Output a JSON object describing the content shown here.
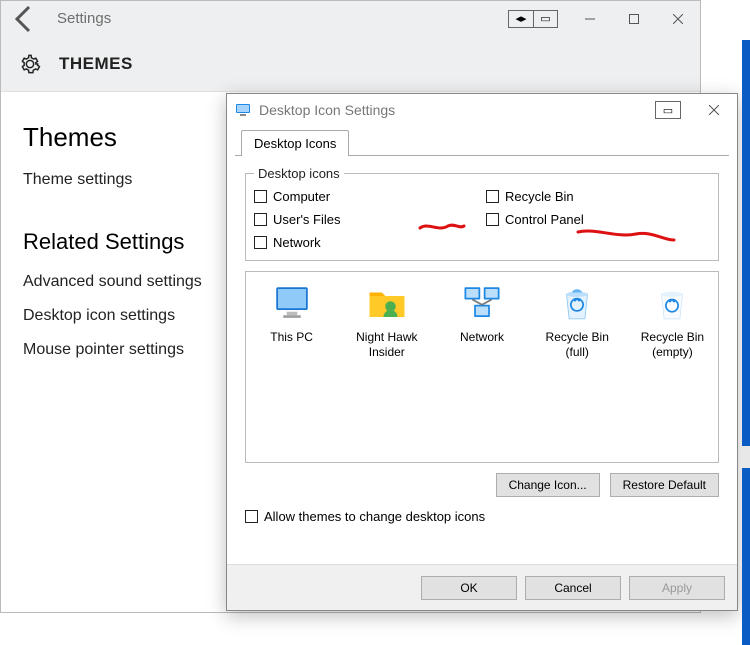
{
  "settings": {
    "app_title": "Settings",
    "header": "THEMES",
    "section_title": "Themes",
    "section_link": "Theme settings",
    "related_title": "Related Settings",
    "related_links": [
      "Advanced sound settings",
      "Desktop icon settings",
      "Mouse pointer settings"
    ]
  },
  "dialog": {
    "title": "Desktop Icon Settings",
    "tab": "Desktop Icons",
    "group_legend": "Desktop icons",
    "checkboxes": {
      "computer": "Computer",
      "recycle_bin": "Recycle Bin",
      "users_files": "User's Files",
      "control_panel": "Control Panel",
      "network": "Network"
    },
    "preview": [
      {
        "label": "This PC",
        "icon": "pc-icon"
      },
      {
        "label": "Night Hawk Insider",
        "icon": "user-folder-icon"
      },
      {
        "label": "Network",
        "icon": "network-icon"
      },
      {
        "label": "Recycle Bin (full)",
        "icon": "bin-full-icon"
      },
      {
        "label": "Recycle Bin (empty)",
        "icon": "bin-empty-icon"
      }
    ],
    "change_icon": "Change Icon...",
    "restore_default": "Restore Default",
    "allow_themes": "Allow themes to change desktop icons",
    "ok": "OK",
    "cancel": "Cancel",
    "apply": "Apply"
  }
}
